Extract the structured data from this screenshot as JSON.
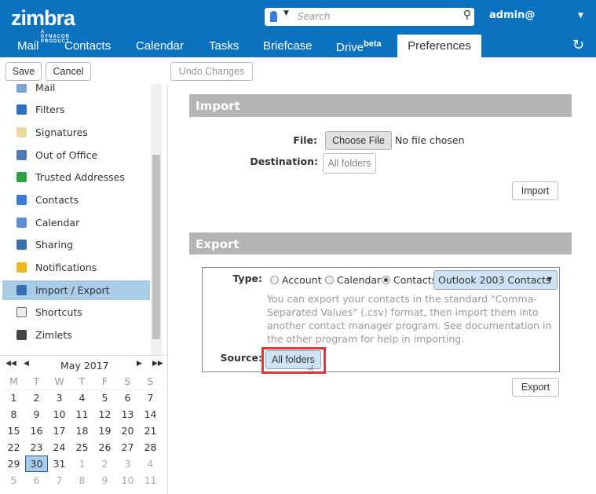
{
  "header": {
    "logo": "zimbra",
    "logo_tagline": "A SYNACOR PRODUCT",
    "search_placeholder": "Search",
    "user": "admin@"
  },
  "tabs": [
    {
      "label": "Mail"
    },
    {
      "label": "Contacts"
    },
    {
      "label": "Calendar"
    },
    {
      "label": "Tasks"
    },
    {
      "label": "Briefcase"
    },
    {
      "label": "Drive",
      "sup": "beta"
    },
    {
      "label": "Preferences",
      "active": true
    }
  ],
  "toolbar": {
    "save": "Save",
    "cancel": "Cancel",
    "undo": "Undo Changes"
  },
  "sidebar": {
    "items": [
      {
        "label": "Mail",
        "icon": "mail-icon"
      },
      {
        "label": "Filters",
        "icon": "filter-icon"
      },
      {
        "label": "Signatures",
        "icon": "signature-icon"
      },
      {
        "label": "Out of Office",
        "icon": "out-of-office-icon"
      },
      {
        "label": "Trusted Addresses",
        "icon": "shield-icon"
      },
      {
        "label": "Contacts",
        "icon": "contact-icon"
      },
      {
        "label": "Calendar",
        "icon": "calendar-icon"
      },
      {
        "label": "Sharing",
        "icon": "sharing-icon"
      },
      {
        "label": "Notifications",
        "icon": "bell-icon"
      },
      {
        "label": "Import / Export",
        "icon": "import-export-icon",
        "selected": true
      },
      {
        "label": "Shortcuts",
        "icon": "shortcut-icon"
      },
      {
        "label": "Zimlets",
        "icon": "zimlet-icon"
      }
    ]
  },
  "calendar": {
    "title": "May 2017",
    "weekdays": [
      "M",
      "T",
      "W",
      "T",
      "F",
      "S",
      "S"
    ],
    "weeks": [
      [
        "1",
        "2",
        "3",
        "4",
        "5",
        "6",
        "7"
      ],
      [
        "8",
        "9",
        "10",
        "11",
        "12",
        "13",
        "14"
      ],
      [
        "15",
        "16",
        "17",
        "18",
        "19",
        "20",
        "21"
      ],
      [
        "22",
        "23",
        "24",
        "25",
        "26",
        "27",
        "28"
      ],
      [
        "29",
        "30",
        "31",
        "1",
        "2",
        "3",
        "4"
      ],
      [
        "5",
        "6",
        "7",
        "8",
        "9",
        "10",
        "11"
      ]
    ],
    "selected": "30"
  },
  "import": {
    "title": "Import",
    "file_label": "File:",
    "choose_file": "Choose File",
    "no_file": "No file chosen",
    "destination_label": "Destination:",
    "destination_value": "All folders",
    "button": "Import"
  },
  "export": {
    "title": "Export",
    "type_label": "Type:",
    "types": [
      "Account",
      "Calendar",
      "Contacts"
    ],
    "selected_type": "Contacts",
    "format": "Outlook 2003 Contacts",
    "description": "You can export your contacts in the standard \"Comma-Separated Values\" (.csv) format, then import them into another contact manager program. See documentation in the other program for help in importing.",
    "source_label": "Source:",
    "source_value": "All folders",
    "button": "Export"
  },
  "colors": {
    "brand": "#0b72bf",
    "selection": "#a8cbe8",
    "highlight": "#e0383a"
  }
}
